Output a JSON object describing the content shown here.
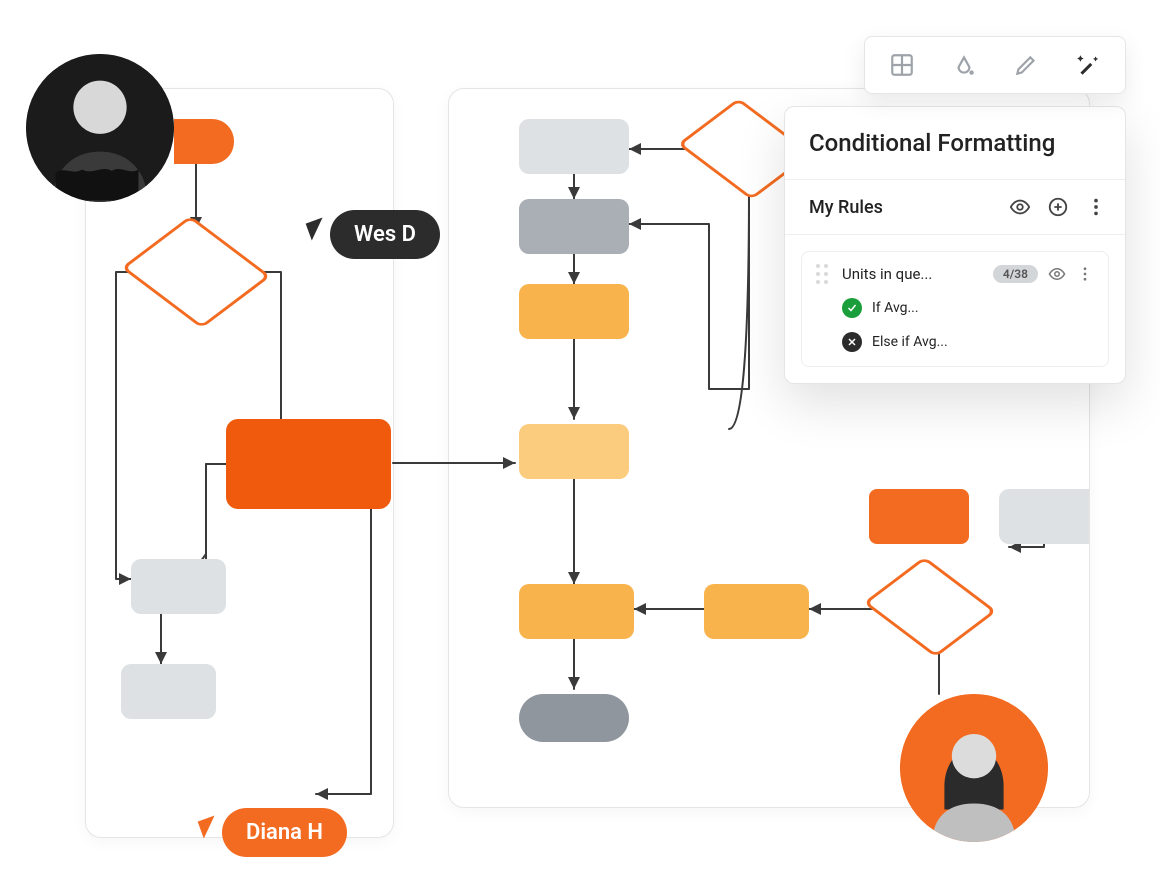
{
  "users": {
    "wes": {
      "label": "Wes D"
    },
    "diana": {
      "label": "Diana H"
    }
  },
  "toolbar": {
    "items": [
      {
        "name": "layout-icon"
      },
      {
        "name": "fill-icon"
      },
      {
        "name": "pencil-icon"
      },
      {
        "name": "magic-icon"
      }
    ]
  },
  "panel": {
    "title": "Conditional Formatting",
    "section": "My Rules",
    "rule": {
      "name": "Units in que...",
      "badge": "4/38",
      "lines": [
        {
          "kind": "ok",
          "text": "If Avg..."
        },
        {
          "kind": "no",
          "text": "Else if Avg..."
        }
      ]
    }
  },
  "colors": {
    "orange": "#F36B21",
    "dark": "#2C2C2C"
  }
}
